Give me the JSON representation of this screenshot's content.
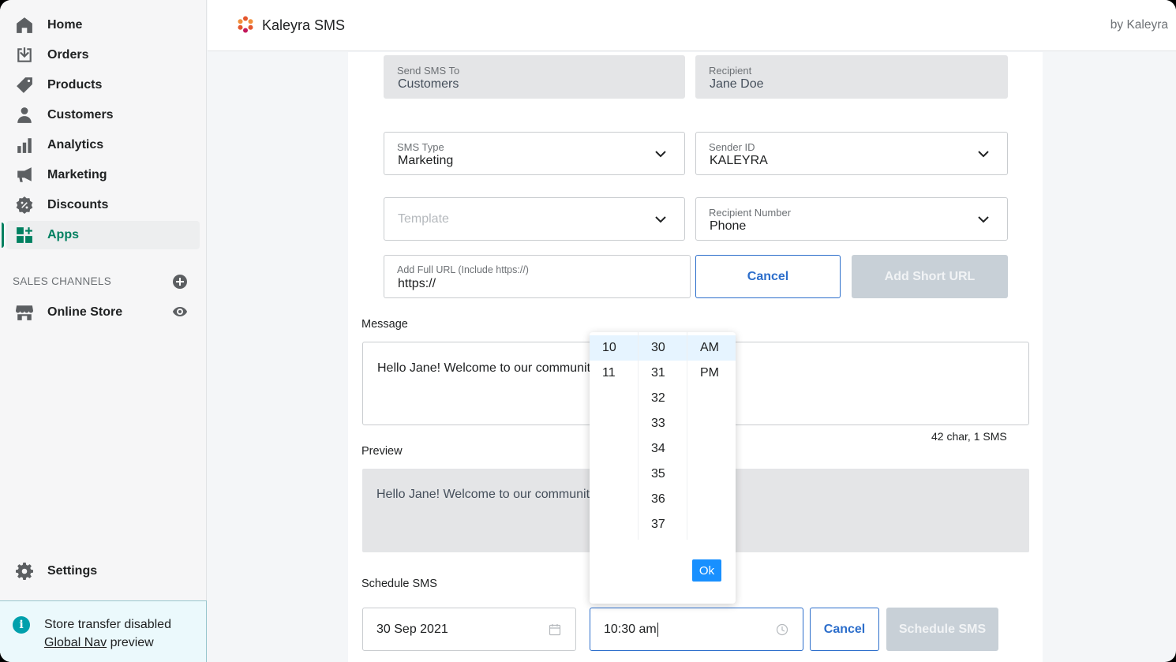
{
  "sidebar": {
    "items": [
      {
        "label": "Home",
        "icon": "home-icon"
      },
      {
        "label": "Orders",
        "icon": "orders-icon"
      },
      {
        "label": "Products",
        "icon": "tag-icon"
      },
      {
        "label": "Customers",
        "icon": "person-icon"
      },
      {
        "label": "Analytics",
        "icon": "bar-chart-icon"
      },
      {
        "label": "Marketing",
        "icon": "megaphone-icon"
      },
      {
        "label": "Discounts",
        "icon": "discount-icon"
      },
      {
        "label": "Apps",
        "icon": "apps-icon",
        "active": true
      }
    ],
    "sales_channels_title": "SALES CHANNELS",
    "online_store_label": "Online Store",
    "settings_label": "Settings",
    "banner": {
      "line1": "Store transfer disabled",
      "link": "Global Nav",
      "suffix": " preview"
    }
  },
  "topbar": {
    "app_title": "Kaleyra SMS",
    "by_label": "by Kaleyra"
  },
  "form": {
    "send_to": {
      "label": "Send SMS To",
      "value": "Customers"
    },
    "recipient": {
      "label": "Recipient",
      "value": "Jane Doe"
    },
    "sms_type": {
      "label": "SMS Type",
      "value": "Marketing"
    },
    "sender_id": {
      "label": "Sender ID",
      "value": "KALEYRA"
    },
    "template": {
      "placeholder": "Template"
    },
    "recipient_number": {
      "label": "Recipient Number",
      "value": "Phone"
    },
    "full_url": {
      "label": "Add Full URL (Include https://)",
      "value": "https://"
    },
    "url_cancel": "Cancel",
    "add_short_url": "Add Short URL",
    "message_label": "Message",
    "message_text": "Hello Jane! Welcome to our community",
    "counter": "42 char, 1 SMS",
    "preview_label": "Preview",
    "preview_text": "Hello Jane! Welcome to our community",
    "schedule_label": "Schedule SMS",
    "date_value": "30 Sep 2021",
    "time_value": "10:30 am",
    "schedule_cancel": "Cancel",
    "schedule_btn": "Schedule SMS"
  },
  "time_picker": {
    "hours": [
      "10",
      "11"
    ],
    "minutes": [
      "30",
      "31",
      "32",
      "33",
      "34",
      "35",
      "36",
      "37"
    ],
    "periods": [
      "AM",
      "PM"
    ],
    "selected": {
      "hour": "10",
      "minute": "30",
      "period": "AM"
    },
    "ok_label": "Ok"
  },
  "colors": {
    "accent": "#2c6ecb",
    "active_nav": "#008060",
    "picker_ok": "#1890ff"
  }
}
